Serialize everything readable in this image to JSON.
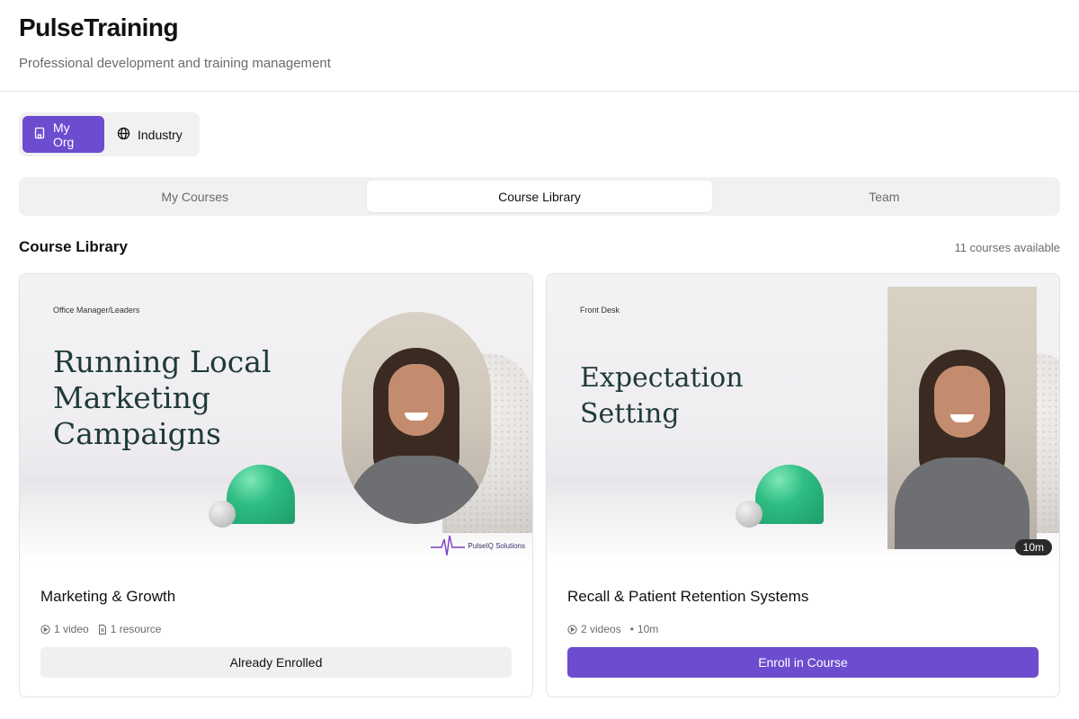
{
  "header": {
    "title": "PulseTraining",
    "subtitle": "Professional development and training management"
  },
  "scope_toggle": {
    "options": [
      {
        "label": "My Org",
        "icon": "building-icon",
        "active": true
      },
      {
        "label": "Industry",
        "icon": "globe-icon",
        "active": false
      }
    ]
  },
  "tabs": [
    {
      "label": "My Courses",
      "active": false
    },
    {
      "label": "Course Library",
      "active": true
    },
    {
      "label": "Team",
      "active": false
    }
  ],
  "section": {
    "title": "Course Library",
    "count_text": "11 courses available"
  },
  "courses": [
    {
      "thumbnail": {
        "category": "Office Manager/Leaders",
        "title": "Running Local Marketing Campaigns",
        "brand_logo": "PulseIQ Solutions"
      },
      "name": "Marketing & Growth",
      "videos": "1 video",
      "resources": "1 resource",
      "action_label": "Already Enrolled"
    },
    {
      "thumbnail": {
        "category": "Front Desk",
        "title": "Expectation Setting",
        "duration_badge": "10m"
      },
      "name": "Recall & Patient Retention Systems",
      "videos": "2 videos",
      "duration": "10m",
      "action_label": "Enroll in Course"
    }
  ],
  "colors": {
    "accent": "#6d4ccf",
    "muted_text": "#6b6b6b",
    "surface": "#f1f1f1"
  }
}
